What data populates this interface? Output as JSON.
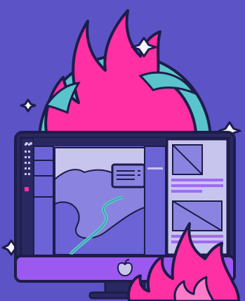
{
  "scene": {
    "kind": "illustration",
    "icons": [
      "sparkle-icon",
      "flame-icon",
      "globe-icon",
      "monitor-icon",
      "apple-logo-icon"
    ]
  },
  "colors": {
    "background": "#5b53c6",
    "outline": "#1e1c4a",
    "flame_pink": "#ff2fa4",
    "globe_teal": "#59c4cc",
    "monitor_frame": "#2a2860",
    "screen_light": "#c7c4ee",
    "screen_mid": "#8a84e0",
    "screen_dark": "#6b63d6",
    "chin_purple": "#9b59f0",
    "accent_purple": "#a06af2",
    "sparkle_white": "#f4f4ff"
  }
}
